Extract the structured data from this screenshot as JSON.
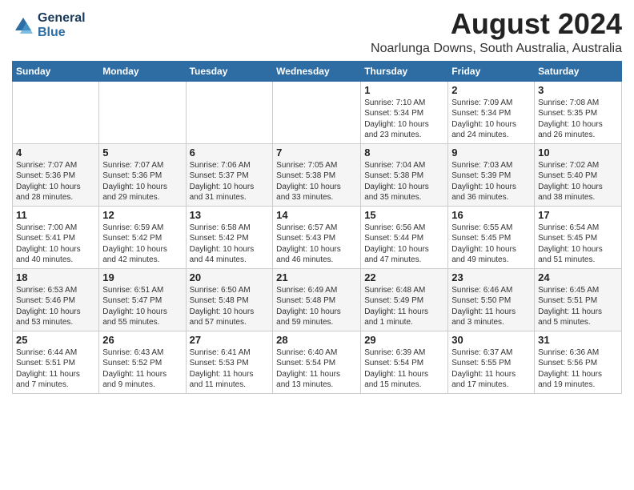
{
  "header": {
    "logo_line1": "General",
    "logo_line2": "Blue",
    "month_year": "August 2024",
    "location": "Noarlunga Downs, South Australia, Australia"
  },
  "days_of_week": [
    "Sunday",
    "Monday",
    "Tuesday",
    "Wednesday",
    "Thursday",
    "Friday",
    "Saturday"
  ],
  "weeks": [
    [
      {
        "day": "",
        "info": ""
      },
      {
        "day": "",
        "info": ""
      },
      {
        "day": "",
        "info": ""
      },
      {
        "day": "",
        "info": ""
      },
      {
        "day": "1",
        "info": "Sunrise: 7:10 AM\nSunset: 5:34 PM\nDaylight: 10 hours\nand 23 minutes."
      },
      {
        "day": "2",
        "info": "Sunrise: 7:09 AM\nSunset: 5:34 PM\nDaylight: 10 hours\nand 24 minutes."
      },
      {
        "day": "3",
        "info": "Sunrise: 7:08 AM\nSunset: 5:35 PM\nDaylight: 10 hours\nand 26 minutes."
      }
    ],
    [
      {
        "day": "4",
        "info": "Sunrise: 7:07 AM\nSunset: 5:36 PM\nDaylight: 10 hours\nand 28 minutes."
      },
      {
        "day": "5",
        "info": "Sunrise: 7:07 AM\nSunset: 5:36 PM\nDaylight: 10 hours\nand 29 minutes."
      },
      {
        "day": "6",
        "info": "Sunrise: 7:06 AM\nSunset: 5:37 PM\nDaylight: 10 hours\nand 31 minutes."
      },
      {
        "day": "7",
        "info": "Sunrise: 7:05 AM\nSunset: 5:38 PM\nDaylight: 10 hours\nand 33 minutes."
      },
      {
        "day": "8",
        "info": "Sunrise: 7:04 AM\nSunset: 5:38 PM\nDaylight: 10 hours\nand 35 minutes."
      },
      {
        "day": "9",
        "info": "Sunrise: 7:03 AM\nSunset: 5:39 PM\nDaylight: 10 hours\nand 36 minutes."
      },
      {
        "day": "10",
        "info": "Sunrise: 7:02 AM\nSunset: 5:40 PM\nDaylight: 10 hours\nand 38 minutes."
      }
    ],
    [
      {
        "day": "11",
        "info": "Sunrise: 7:00 AM\nSunset: 5:41 PM\nDaylight: 10 hours\nand 40 minutes."
      },
      {
        "day": "12",
        "info": "Sunrise: 6:59 AM\nSunset: 5:42 PM\nDaylight: 10 hours\nand 42 minutes."
      },
      {
        "day": "13",
        "info": "Sunrise: 6:58 AM\nSunset: 5:42 PM\nDaylight: 10 hours\nand 44 minutes."
      },
      {
        "day": "14",
        "info": "Sunrise: 6:57 AM\nSunset: 5:43 PM\nDaylight: 10 hours\nand 46 minutes."
      },
      {
        "day": "15",
        "info": "Sunrise: 6:56 AM\nSunset: 5:44 PM\nDaylight: 10 hours\nand 47 minutes."
      },
      {
        "day": "16",
        "info": "Sunrise: 6:55 AM\nSunset: 5:45 PM\nDaylight: 10 hours\nand 49 minutes."
      },
      {
        "day": "17",
        "info": "Sunrise: 6:54 AM\nSunset: 5:45 PM\nDaylight: 10 hours\nand 51 minutes."
      }
    ],
    [
      {
        "day": "18",
        "info": "Sunrise: 6:53 AM\nSunset: 5:46 PM\nDaylight: 10 hours\nand 53 minutes."
      },
      {
        "day": "19",
        "info": "Sunrise: 6:51 AM\nSunset: 5:47 PM\nDaylight: 10 hours\nand 55 minutes."
      },
      {
        "day": "20",
        "info": "Sunrise: 6:50 AM\nSunset: 5:48 PM\nDaylight: 10 hours\nand 57 minutes."
      },
      {
        "day": "21",
        "info": "Sunrise: 6:49 AM\nSunset: 5:48 PM\nDaylight: 10 hours\nand 59 minutes."
      },
      {
        "day": "22",
        "info": "Sunrise: 6:48 AM\nSunset: 5:49 PM\nDaylight: 11 hours\nand 1 minute."
      },
      {
        "day": "23",
        "info": "Sunrise: 6:46 AM\nSunset: 5:50 PM\nDaylight: 11 hours\nand 3 minutes."
      },
      {
        "day": "24",
        "info": "Sunrise: 6:45 AM\nSunset: 5:51 PM\nDaylight: 11 hours\nand 5 minutes."
      }
    ],
    [
      {
        "day": "25",
        "info": "Sunrise: 6:44 AM\nSunset: 5:51 PM\nDaylight: 11 hours\nand 7 minutes."
      },
      {
        "day": "26",
        "info": "Sunrise: 6:43 AM\nSunset: 5:52 PM\nDaylight: 11 hours\nand 9 minutes."
      },
      {
        "day": "27",
        "info": "Sunrise: 6:41 AM\nSunset: 5:53 PM\nDaylight: 11 hours\nand 11 minutes."
      },
      {
        "day": "28",
        "info": "Sunrise: 6:40 AM\nSunset: 5:54 PM\nDaylight: 11 hours\nand 13 minutes."
      },
      {
        "day": "29",
        "info": "Sunrise: 6:39 AM\nSunset: 5:54 PM\nDaylight: 11 hours\nand 15 minutes."
      },
      {
        "day": "30",
        "info": "Sunrise: 6:37 AM\nSunset: 5:55 PM\nDaylight: 11 hours\nand 17 minutes."
      },
      {
        "day": "31",
        "info": "Sunrise: 6:36 AM\nSunset: 5:56 PM\nDaylight: 11 hours\nand 19 minutes."
      }
    ]
  ]
}
